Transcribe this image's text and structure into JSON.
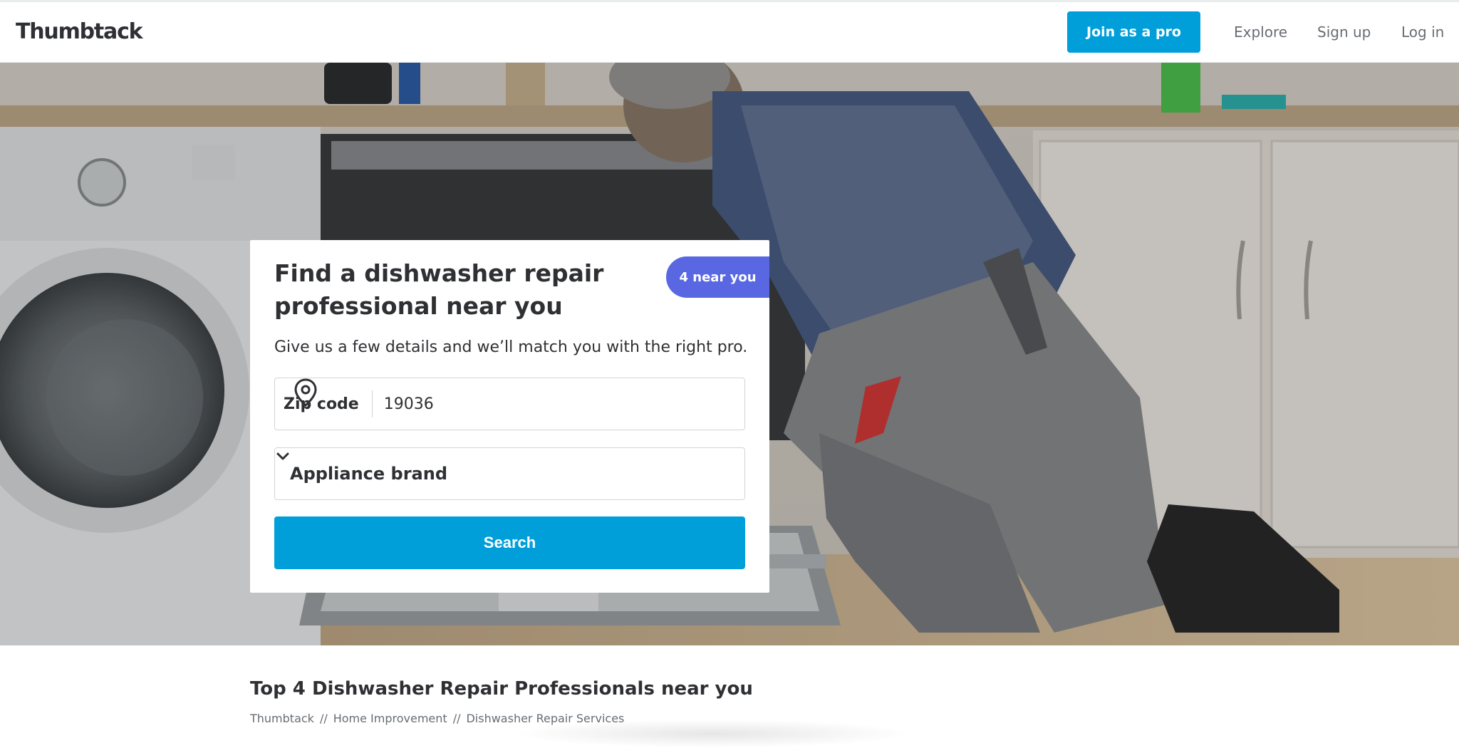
{
  "header": {
    "logo": "Thumbtack",
    "join_label": "Join as a pro",
    "nav": {
      "explore": "Explore",
      "signup": "Sign up",
      "login": "Log in"
    }
  },
  "card": {
    "title": "Find a dishwasher repair professional near you",
    "badge": "4 near you",
    "subtitle": "Give us a few details and we’ll match you with the right pro.",
    "zip_label": "Zip code",
    "zip_value": "19036",
    "brand_select": "Appliance brand",
    "search_label": "Search"
  },
  "results": {
    "title": "Top 4 Dishwasher Repair Professionals near you",
    "breadcrumb": [
      "Thumbtack",
      "Home Improvement",
      "Dishwasher Repair Services"
    ],
    "breadcrumb_separator": "//"
  },
  "icons": {
    "pin": "map-pin-icon",
    "chevron": "chevron-down-icon"
  },
  "colors": {
    "brand_blue": "#009fd9",
    "badge_purple": "#5968e2",
    "text": "#2f3033",
    "muted": "#676d73"
  }
}
